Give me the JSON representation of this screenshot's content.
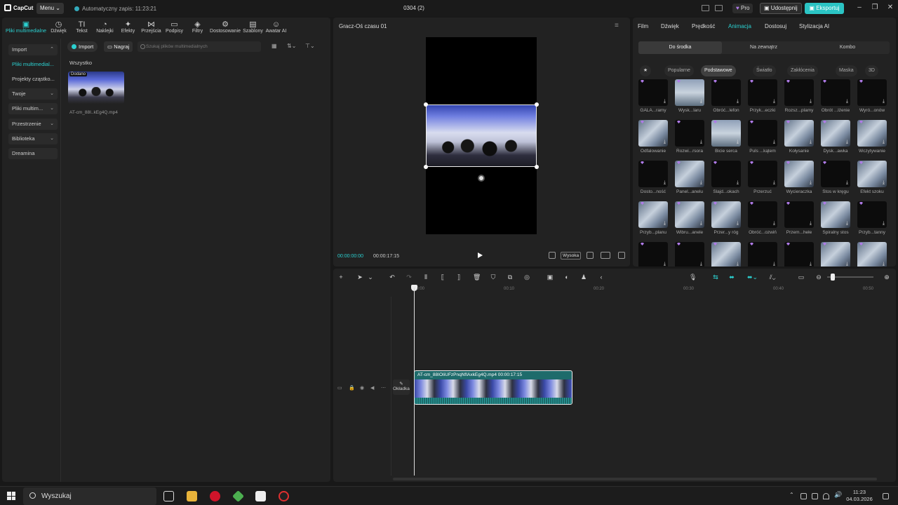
{
  "app": {
    "logo_text": "CapCut",
    "menu_label": "Menu",
    "autosave": "Automatyczny zapis: 11:23:21",
    "project_title": "0304 (2)",
    "pro_label": "Pro",
    "share_label": "Udostępnij",
    "export_label": "Eksportuj"
  },
  "tools": [
    {
      "label": "Pliki multimedialne",
      "icon": "media-icon",
      "glyph": "▣"
    },
    {
      "label": "Dźwięk",
      "icon": "audio-icon",
      "glyph": "◷"
    },
    {
      "label": "Tekst",
      "icon": "text-icon",
      "glyph": "TI"
    },
    {
      "label": "Naklejki",
      "icon": "sticker-icon",
      "glyph": "◔"
    },
    {
      "label": "Efekty",
      "icon": "effects-icon",
      "glyph": "✦"
    },
    {
      "label": "Przejścia",
      "icon": "transitions-icon",
      "glyph": "⋈"
    },
    {
      "label": "Podpisy",
      "icon": "captions-icon",
      "glyph": "▭"
    },
    {
      "label": "Filtry",
      "icon": "filters-icon",
      "glyph": "◈"
    },
    {
      "label": "Dostosowanie",
      "icon": "adjust-icon",
      "glyph": "⚙"
    },
    {
      "label": "Szablony",
      "icon": "templates-icon",
      "glyph": "▤"
    },
    {
      "label": "Awatar AI",
      "icon": "avatar-icon",
      "glyph": "☺"
    }
  ],
  "sidebar": [
    {
      "label": "Import",
      "chevron": "⌃"
    },
    {
      "label": "Pliki multimedial..."
    },
    {
      "label": "Projekty cząstko..."
    },
    {
      "label": "Twoje",
      "chevron": "⌄"
    },
    {
      "label": "Pliki multim...",
      "chevron": "⌄"
    },
    {
      "label": "Przestrzenie",
      "chevron": "⌄"
    },
    {
      "label": "Biblioteka",
      "chevron": "⌄"
    },
    {
      "label": "Dreamina"
    }
  ],
  "media": {
    "import_label": "Import",
    "record_label": "Nagraj",
    "search_placeholder": "Szukaj plików multimedialnych",
    "all_label": "Wszystko",
    "added_badge": "Dodano",
    "file_name": "AT-cm_88I..kEg4Q.mp4"
  },
  "player": {
    "title": "Gracz-Oś czasu 01",
    "time_current": "00:00:00:00",
    "time_total": "00:00:17:15",
    "quality_label": "Wysoka"
  },
  "properties": {
    "tabs": [
      "Film",
      "Dźwięk",
      "Prędkość",
      "Animacja",
      "Dostosuj",
      "Stylizacja AI"
    ],
    "subtabs": [
      "Do środka",
      "Na zewnątrz",
      "Kombo"
    ],
    "categories": [
      "Popularne",
      "Podstawowe",
      "Światło",
      "Zakłócenia",
      "Maska",
      "3D"
    ],
    "star_glyph": "★",
    "animations": [
      "GALA...ramy",
      "Wysk...laru",
      "Obróć...lefon",
      "Przyk...eczki",
      "Rozsz...plamy",
      "Obrót ...lżenie",
      "Wyró...onów",
      "Odfalowanie",
      "Rozwi...rsora",
      "Bicie serca",
      "Puls ...kątem",
      "Kołysanie",
      "Dysk...awka",
      "Wczytywanie",
      "Dosto...ność",
      "Panel...anelu",
      "Slajd...okach",
      "Przerzuć",
      "Wycieraczka",
      "Stos w kręgu",
      "Efekt szoku",
      "Przyb...planu",
      "Wibru...anele",
      "Przer...y róg",
      "Obróć...ozwiń",
      "Przem...hełe",
      "Spiralny stos",
      "Przyb...tanny",
      "",
      "",
      "",
      "",
      "",
      "",
      ""
    ]
  },
  "timeline": {
    "ruler_ticks": [
      "00:00",
      "00:10",
      "00:20",
      "00:30",
      "00:40",
      "00:50"
    ],
    "cover_label": "Okładka",
    "clip_label": "AT-cm_88IOIiUFzPnqNfIAxkEg4Q.mp4  00:00:17:15"
  },
  "taskbar": {
    "search_label": "Wyszukaj",
    "time": "11:23",
    "date": "04.03.2026"
  },
  "colors": {
    "accent": "#2bd0d0",
    "export_bg": "#2bc4c4",
    "panel_bg": "#222222",
    "app_bg": "#181818"
  }
}
